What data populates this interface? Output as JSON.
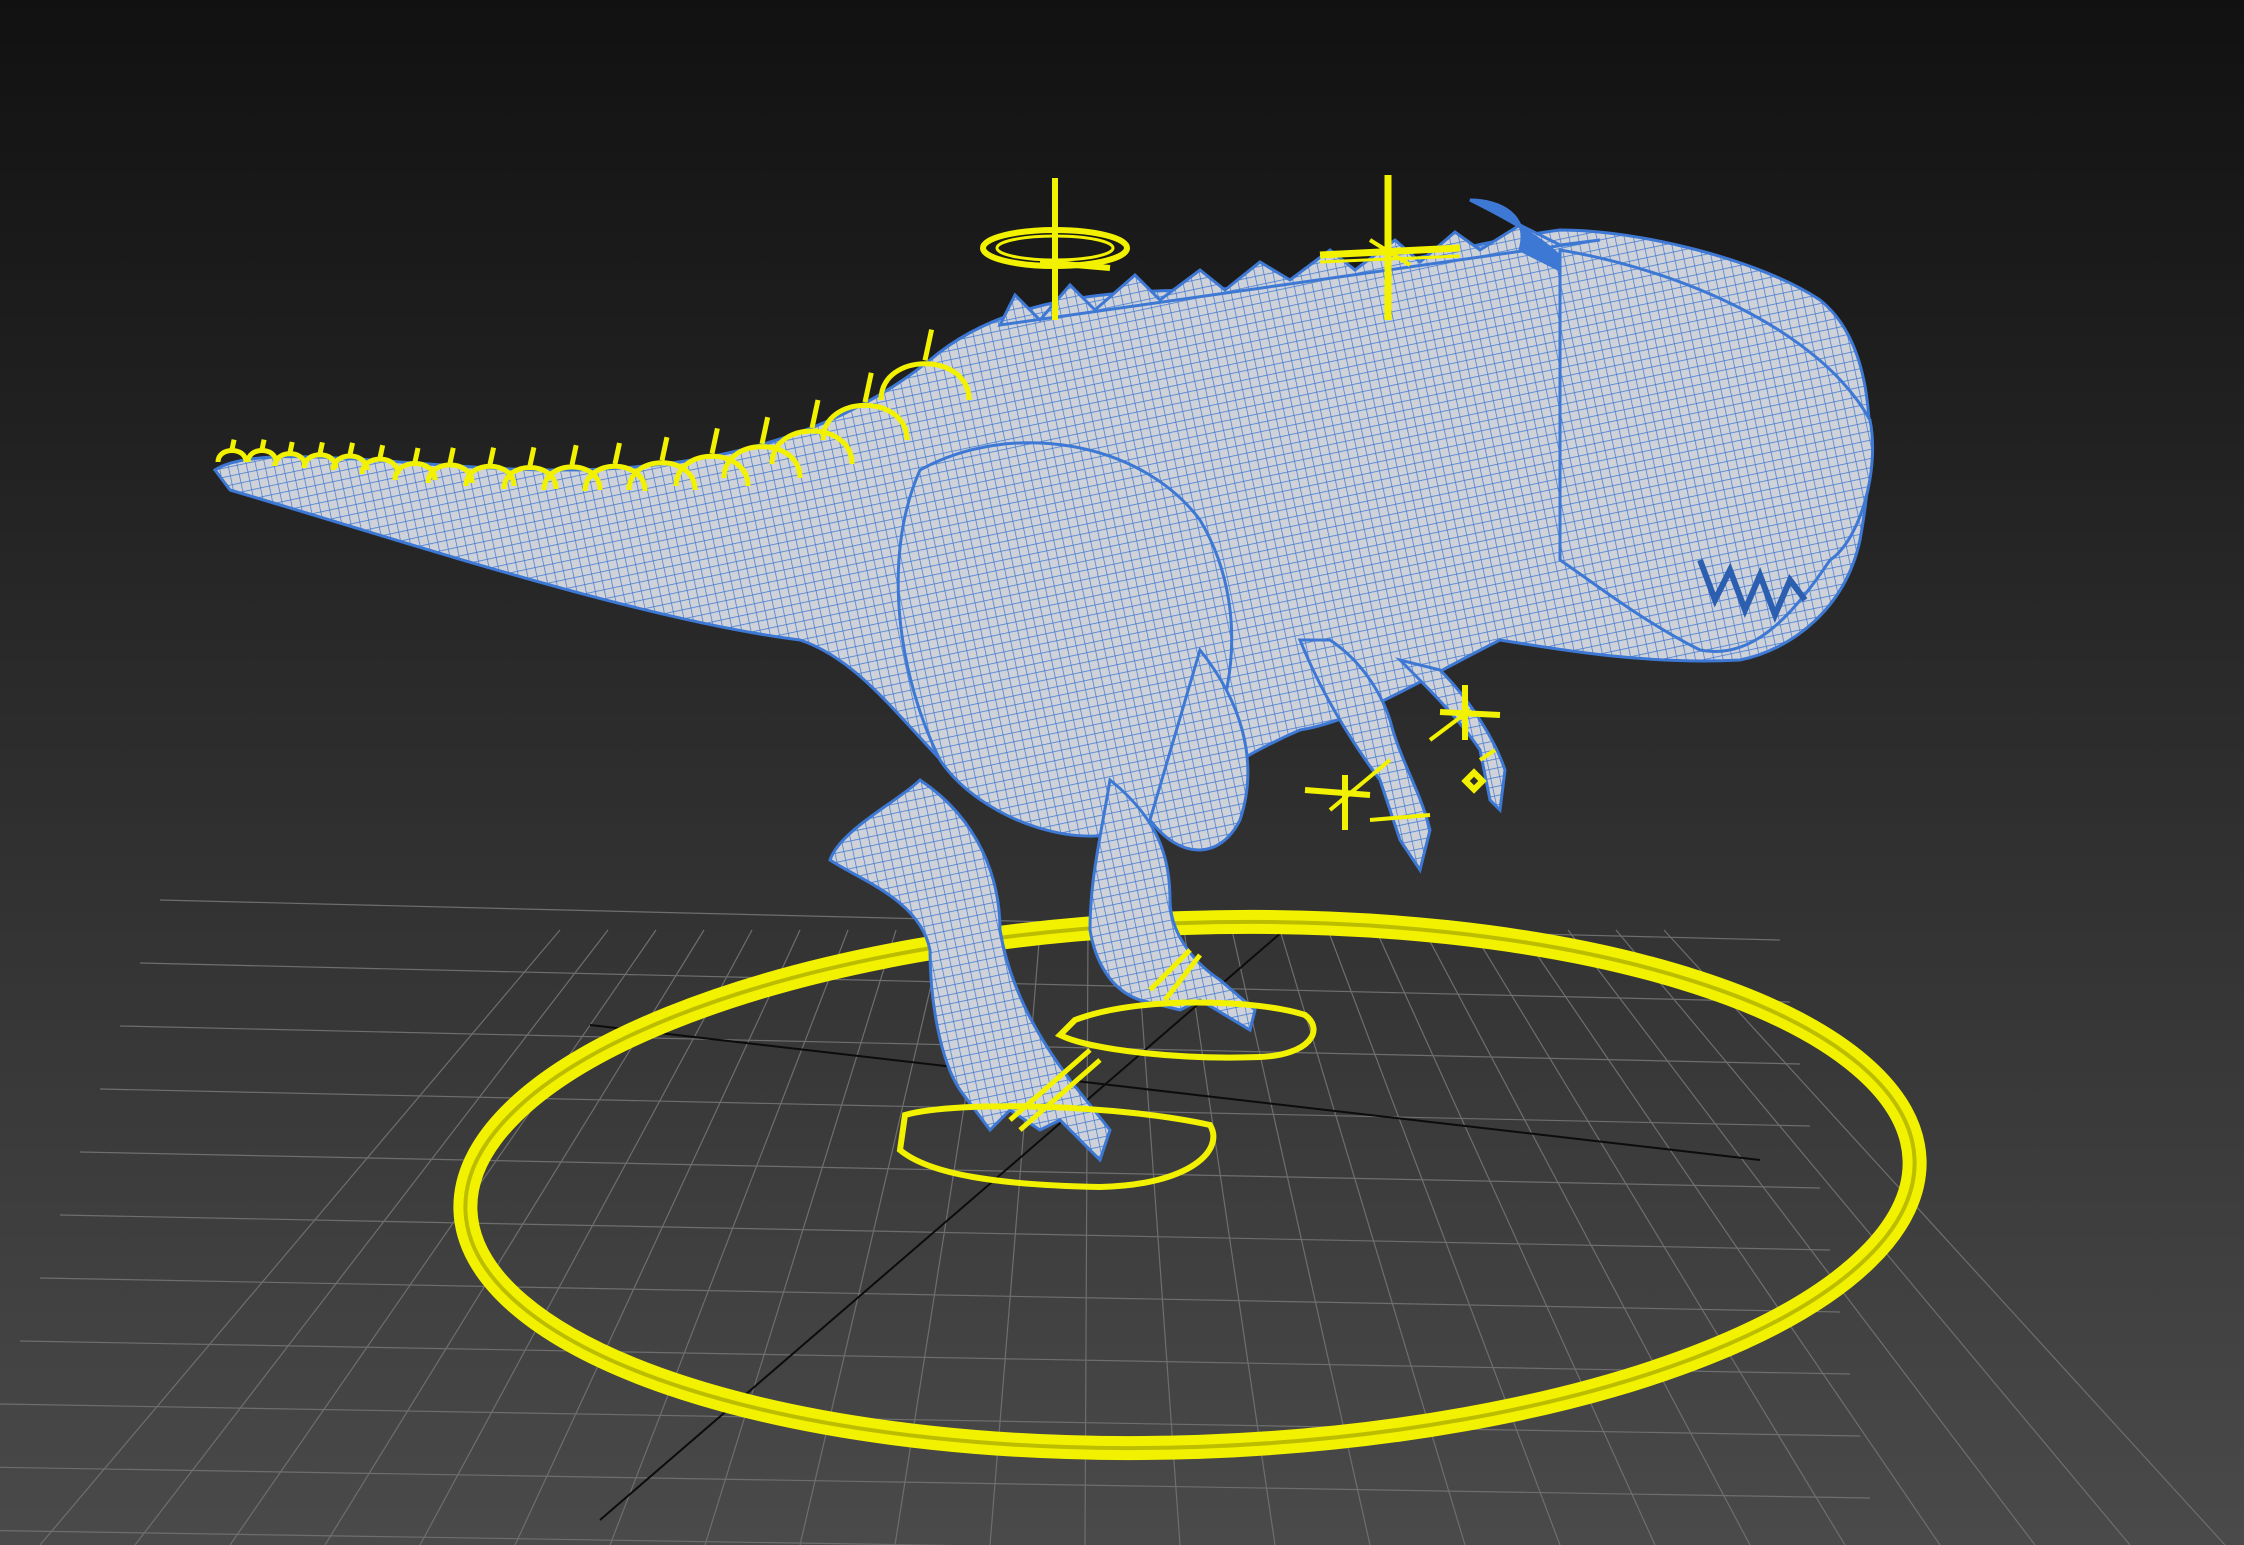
{
  "viewport": {
    "label": "",
    "mesh_color": "#3d78d4",
    "mesh_fill": "#c9ccd2",
    "control_color": "#f2f200",
    "grid_color": "#707070",
    "grid_axis_color": "#0c0c0c",
    "background_top": "#111111",
    "background_bottom": "#494949"
  },
  "scene": {
    "model": "creature-dinosaur-mesh",
    "controls": [
      {
        "name": "root-circle-control"
      },
      {
        "name": "left-foot-control"
      },
      {
        "name": "right-foot-control"
      },
      {
        "name": "pelvis-control"
      },
      {
        "name": "chest-control"
      },
      {
        "name": "left-hand-control"
      },
      {
        "name": "right-hand-control"
      },
      {
        "name": "tail-spine-controls"
      }
    ]
  }
}
